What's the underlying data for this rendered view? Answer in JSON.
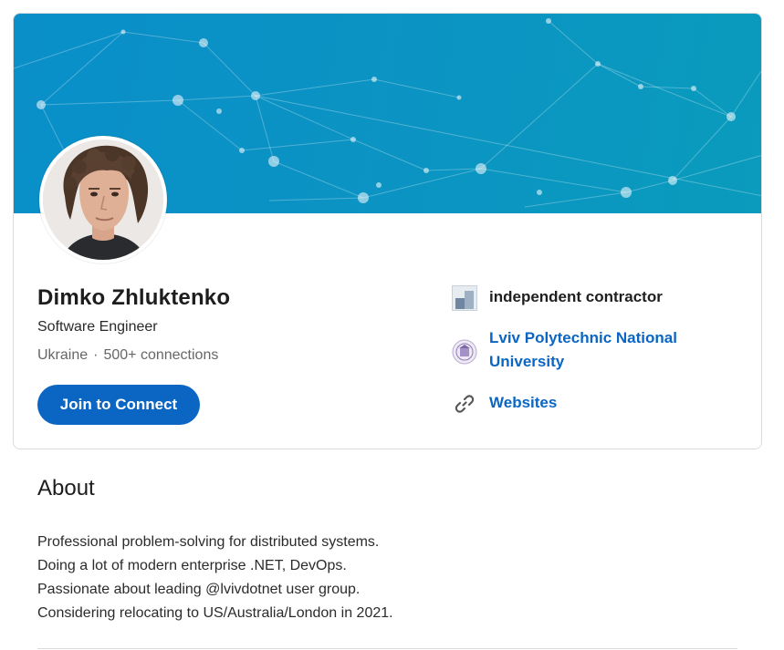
{
  "profile": {
    "name": "Dimko Zhluktenko",
    "headline": "Software Engineer",
    "location": "Ukraine",
    "separator": "·",
    "connections": "500+ connections",
    "join_button": "Join to Connect"
  },
  "side": {
    "company": {
      "label": "independent contractor",
      "icon": "company-logo-icon"
    },
    "school": {
      "label_line1": "Lviv Polytechnic National",
      "label_line2": "University",
      "icon": "university-crest-icon"
    },
    "websites": {
      "label": "Websites",
      "icon": "link-icon"
    }
  },
  "about": {
    "title": "About",
    "lines": [
      "Professional problem-solving for distributed systems.",
      "Doing a lot of modern enterprise .NET, DevOps.",
      "Passionate about leading @lvivdotnet user group.",
      "Considering relocating to US/Australia/London in 2021."
    ]
  },
  "colors": {
    "accent": "#0a66c2",
    "banner": "#0b93c4"
  }
}
